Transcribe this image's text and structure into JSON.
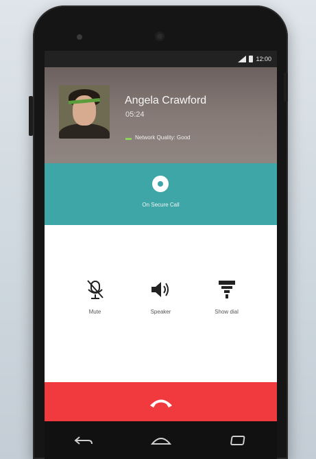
{
  "status_bar": {
    "time": "12:00"
  },
  "contact": {
    "name": "Angela Crawford",
    "duration": "05:24",
    "network_quality": "Network Quality: Good"
  },
  "record": {
    "label": "On Secure Call"
  },
  "controls": [
    {
      "label": "Mute",
      "icon": "mic-off-icon"
    },
    {
      "label": "Speaker",
      "icon": "speaker-icon"
    },
    {
      "label": "Show dial",
      "icon": "dialpad-icon"
    }
  ],
  "end_call": {
    "icon": "end-call-icon"
  },
  "nav": {
    "back": "back-icon",
    "home": "home-icon",
    "recents": "recents-icon"
  },
  "colors": {
    "accent": "#3ea6a6",
    "end_call": "#f03a3d"
  }
}
